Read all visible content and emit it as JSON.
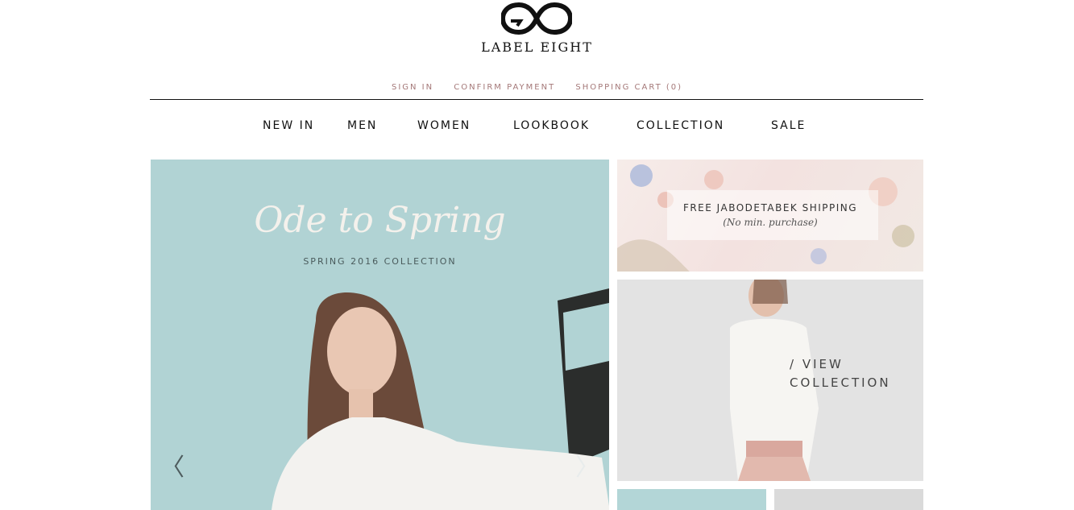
{
  "brand": {
    "name": "LABEL EIGHT",
    "logo_icon": "infinity-logo-icon"
  },
  "utility_nav": {
    "sign_in": "SIGN IN",
    "confirm_payment": "CONFIRM PAYMENT",
    "shopping_cart": "SHOPPING CART (0)"
  },
  "main_nav": {
    "items": [
      {
        "label": "NEW IN"
      },
      {
        "label": "MEN"
      },
      {
        "label": "WOMEN"
      },
      {
        "label": "LOOKBOOK"
      },
      {
        "label": "COLLECTION"
      },
      {
        "label": "SALE"
      }
    ]
  },
  "hero": {
    "title": "Ode to Spring",
    "subtitle": "SPRING 2016 COLLECTION",
    "prev_icon": "chevron-left-icon",
    "next_icon": "chevron-right-icon",
    "prev_glyph": "〈",
    "next_glyph": "〉",
    "background_color": "#b1d3d4"
  },
  "promo_shipping": {
    "title": "FREE JABODETABEK SHIPPING",
    "subtitle": "(No min. purchase)"
  },
  "promo_collection": {
    "line1": "/ VIEW",
    "line2": "COLLECTION"
  },
  "colors": {
    "utility_link": "#a47878",
    "text": "#111111",
    "hero_bg": "#b1d3d4"
  }
}
